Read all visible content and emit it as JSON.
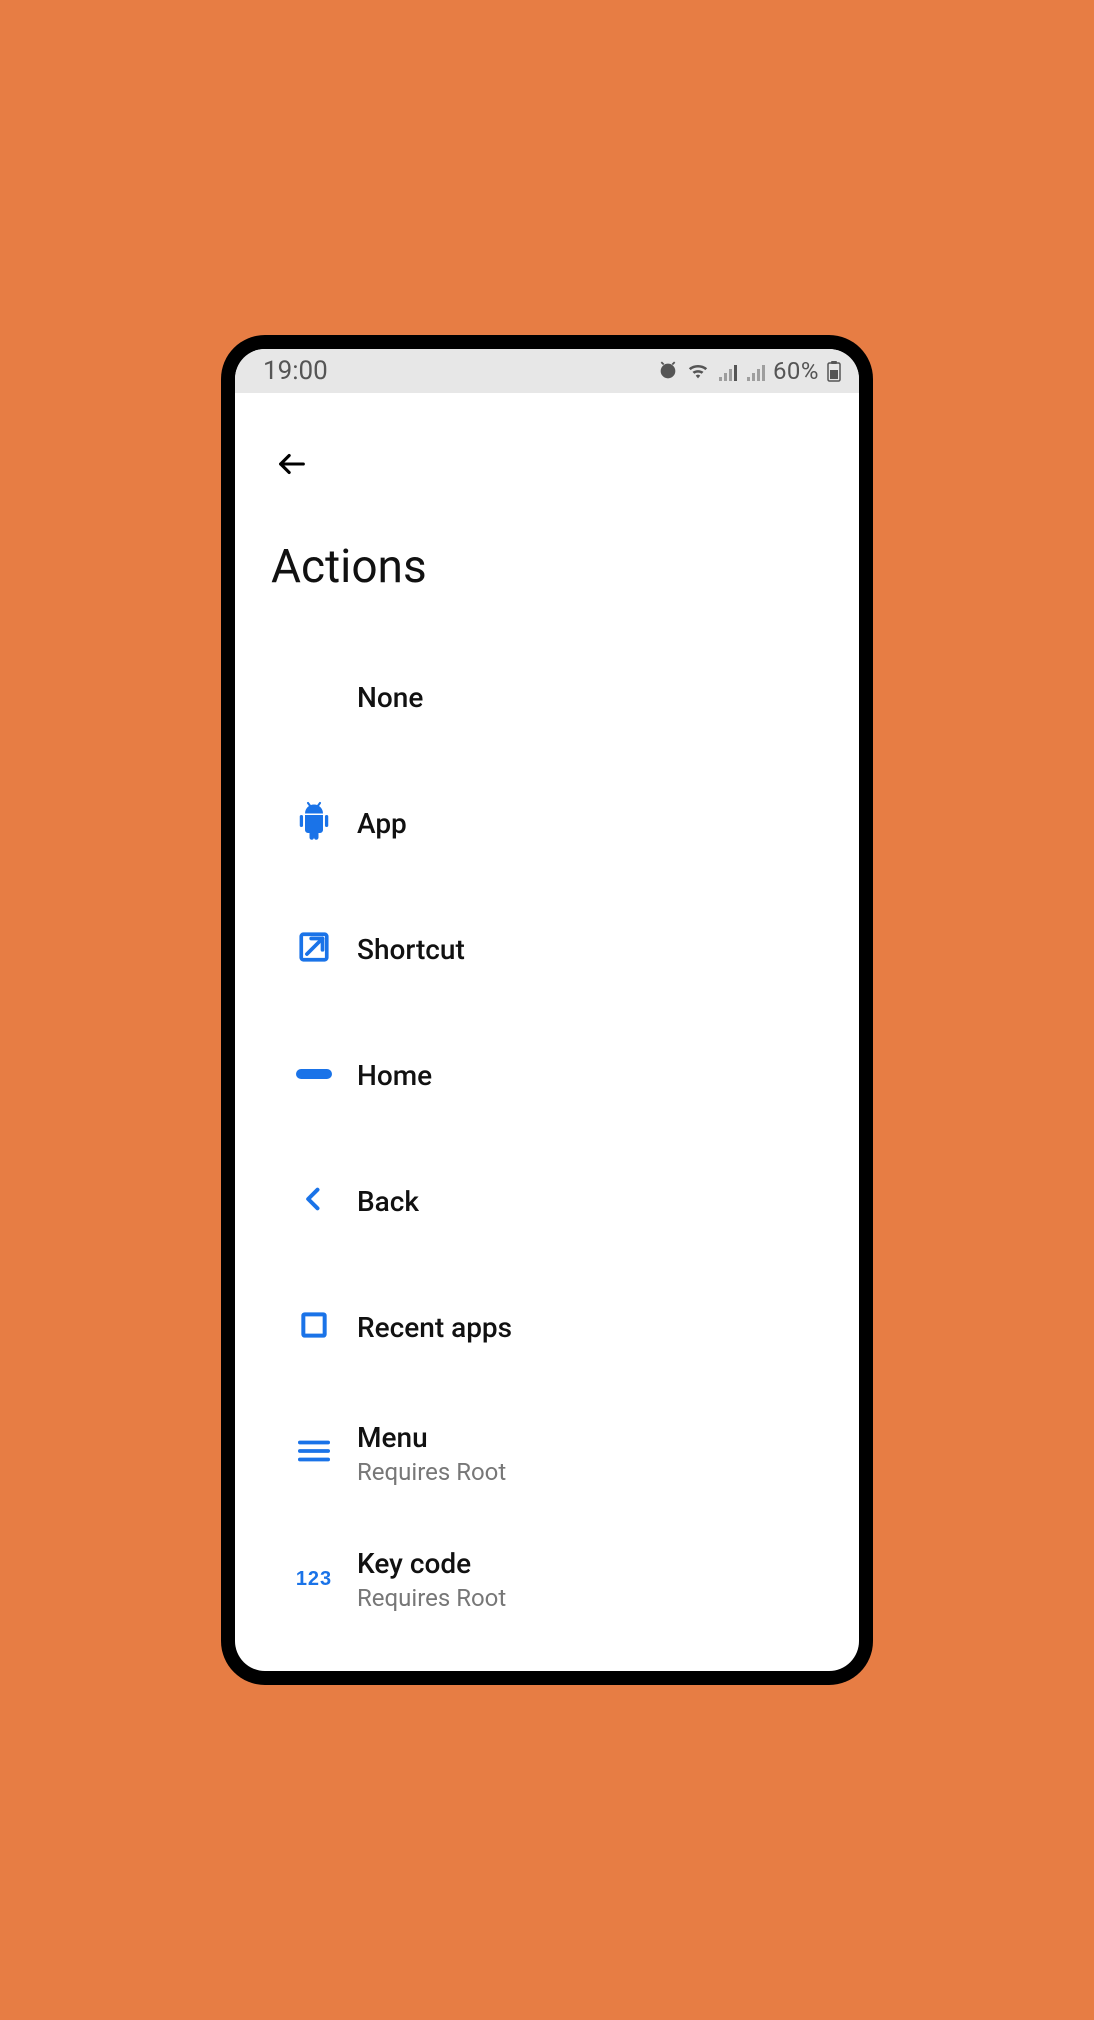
{
  "status": {
    "time": "19:00",
    "battery": "60%"
  },
  "page": {
    "title": "Actions"
  },
  "items": {
    "none": {
      "label": "None"
    },
    "app": {
      "label": "App"
    },
    "shortcut": {
      "label": "Shortcut"
    },
    "home": {
      "label": "Home"
    },
    "back": {
      "label": "Back"
    },
    "recent": {
      "label": "Recent apps"
    },
    "menu": {
      "label": "Menu",
      "sub": "Requires Root"
    },
    "keycode": {
      "label": "Key code",
      "sub": "Requires Root",
      "icon_text": "123"
    }
  }
}
